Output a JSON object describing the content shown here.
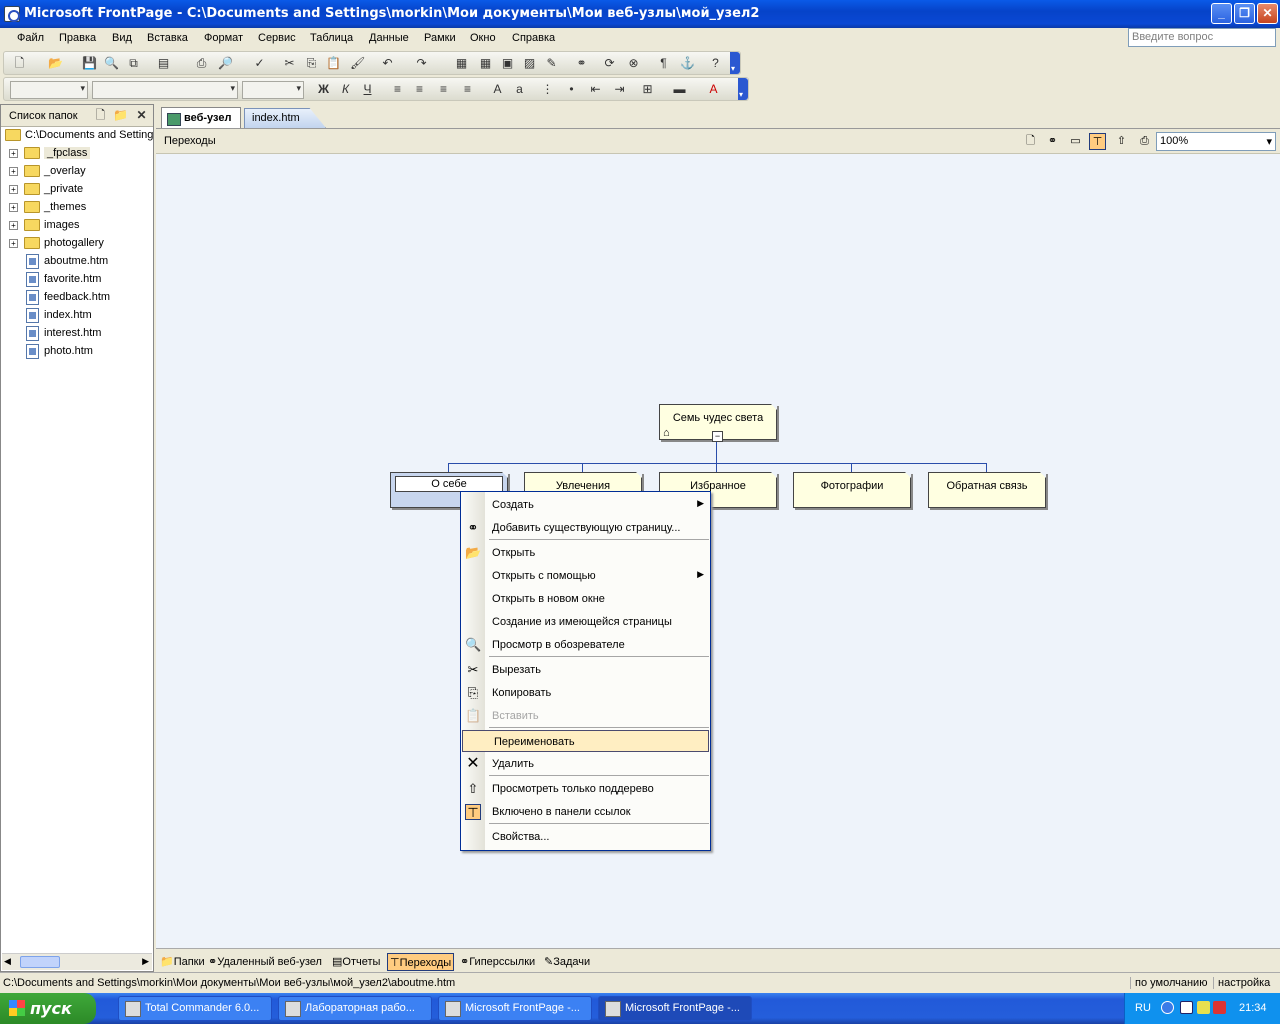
{
  "window": {
    "title": "Microsoft FrontPage - C:\\Documents and Settings\\morkin\\Мои документы\\Мои веб-узлы\\мой_узел2"
  },
  "menu": [
    {
      "label": "Файл"
    },
    {
      "label": "Правка"
    },
    {
      "label": "Вид"
    },
    {
      "label": "Вставка"
    },
    {
      "label": "Формат"
    },
    {
      "label": "Сервис"
    },
    {
      "label": "Таблица"
    },
    {
      "label": "Данные"
    },
    {
      "label": "Рамки"
    },
    {
      "label": "Окно"
    },
    {
      "label": "Справка"
    }
  ],
  "help_placeholder": "Введите вопрос",
  "folder_pane": {
    "title": "Список папок",
    "root": "C:\\Documents and Setting",
    "items": [
      {
        "label": "_fpclass",
        "type": "folder",
        "expand": "+"
      },
      {
        "label": "_overlay",
        "type": "folder",
        "expand": "+"
      },
      {
        "label": "_private",
        "type": "folder",
        "expand": "+"
      },
      {
        "label": "_themes",
        "type": "folder",
        "expand": "+"
      },
      {
        "label": "images",
        "type": "folder",
        "expand": "+"
      },
      {
        "label": "photogallery",
        "type": "folder",
        "expand": "+"
      },
      {
        "label": "aboutme.htm",
        "type": "page"
      },
      {
        "label": "favorite.htm",
        "type": "page"
      },
      {
        "label": "feedback.htm",
        "type": "page"
      },
      {
        "label": "index.htm",
        "type": "page"
      },
      {
        "label": "interest.htm",
        "type": "page"
      },
      {
        "label": "photo.htm",
        "type": "page"
      }
    ]
  },
  "tabs": {
    "web": "веб-узел",
    "index": "index.htm"
  },
  "nav": {
    "title": "Переходы",
    "zoom": "100%"
  },
  "tree": {
    "root": "Семь чудес света",
    "children": [
      "О себе",
      "Увлечения",
      "Избранное",
      "Фотографии",
      "Обратная связь"
    ]
  },
  "view_tabs": [
    "Папки",
    "Удаленный веб-узел",
    "Отчеты",
    "Переходы",
    "Гиперссылки",
    "Задачи"
  ],
  "context_menu": [
    {
      "label": "Создать",
      "submenu": true
    },
    {
      "label": "Добавить существующую страницу...",
      "icon": "add-page-icon"
    },
    {
      "label": "Открыть",
      "icon": "open-folder-icon"
    },
    {
      "label": "Открыть с помощью",
      "submenu": true
    },
    {
      "label": "Открыть в новом окне"
    },
    {
      "label": "Создание из имеющейся страницы"
    },
    {
      "label": "Просмотр в обозревателе",
      "icon": "preview-icon"
    },
    {
      "label": "Вырезать",
      "icon": "cut-icon"
    },
    {
      "label": "Копировать",
      "icon": "copy-icon"
    },
    {
      "label": "Вставить",
      "icon": "paste-icon",
      "disabled": true
    },
    {
      "label": "Переименовать",
      "highlighted": true
    },
    {
      "label": "Удалить",
      "icon": "delete-icon"
    },
    {
      "label": "Просмотреть только поддерево",
      "icon": "subtree-icon"
    },
    {
      "label": "Включено в панели ссылок",
      "icon": "link-bar-icon"
    },
    {
      "label": "Свойства..."
    }
  ],
  "status": {
    "path": "C:\\Documents and Settings\\morkin\\Мои документы\\Мои веб-узлы\\мой_узел2\\aboutme.htm",
    "mode": "по умолчанию",
    "custom": "настройка"
  },
  "taskbar": {
    "start": "пуск",
    "tasks": [
      "Total Commander 6.0...",
      "Лабораторная рабо...",
      "Microsoft FrontPage -...",
      "Microsoft FrontPage -..."
    ],
    "lang": "RU",
    "clock": "21:34"
  },
  "colors": {
    "title_blue": "#0a5ae8",
    "node_fill": "#ffffe1",
    "canvas": "#eef3fa",
    "highlight": "#ffeec2",
    "active_tab": "#ffcc80"
  }
}
